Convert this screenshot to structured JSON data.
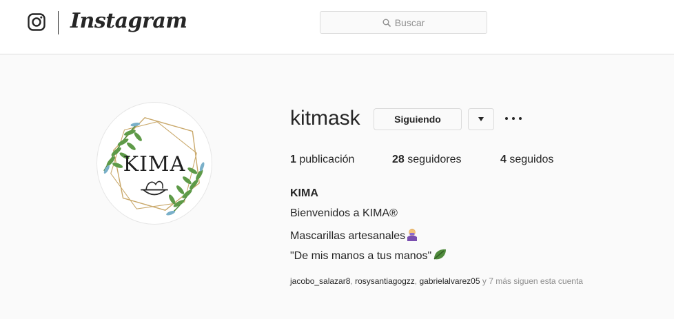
{
  "header": {
    "wordmark": "Instagram",
    "search_placeholder": "Buscar"
  },
  "profile": {
    "avatar_text": "KIMA",
    "username": "kitmask",
    "follow_button_label": "Siguiendo",
    "stats": {
      "posts_count": "1",
      "posts_label": "publicación",
      "followers_count": "28",
      "followers_label": "seguidores",
      "following_count": "4",
      "following_label": "seguidos"
    },
    "bio": {
      "name": "KIMA",
      "line1": "Bienvenidos a KIMA®",
      "line2": "Mascarillas artesanales",
      "line3": "\"De mis manos a tus manos\""
    },
    "followed_by": {
      "accounts": [
        "jacobo_salazar8",
        "rosysantiagogzz",
        "gabrielalvarez05"
      ],
      "suffix": "y 7 más siguen esta cuenta"
    }
  },
  "icons": {
    "logo": "instagram-glyph-icon",
    "search": "search-icon",
    "dropdown": "caret-down-icon",
    "options": "more-options-icon",
    "bio_line2_emoji": "woman-with-mask-emoji",
    "bio_line3_emoji": "leaf-emoji"
  },
  "colors": {
    "text": "#262626",
    "muted": "#8e8e8e",
    "border": "#dbdbdb",
    "background": "#fafafa",
    "leaf_green": "#4f8a3c",
    "gold": "#c9a86a"
  }
}
